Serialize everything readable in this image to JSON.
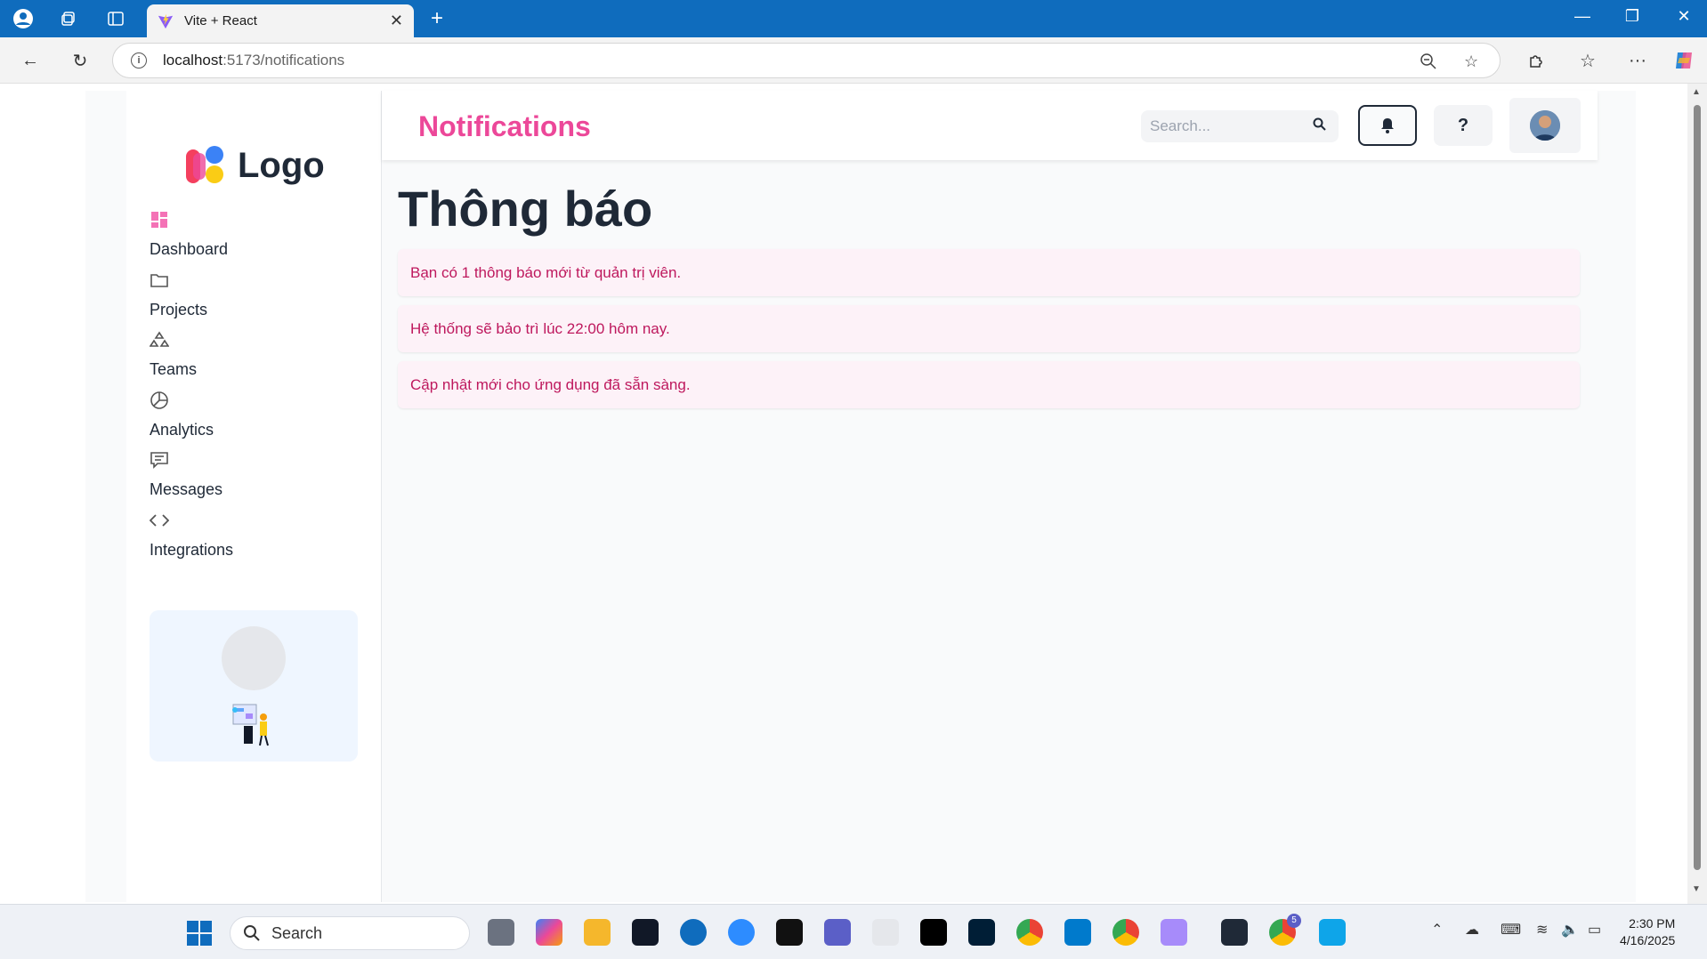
{
  "browser": {
    "tab_title": "Vite + React",
    "url_host": "localhost",
    "url_rest": ":5173/notifications"
  },
  "sidebar": {
    "logo_text": "Logo",
    "items": [
      {
        "label": "Dashboard",
        "icon": "dashboard-grid-icon"
      },
      {
        "label": "Projects",
        "icon": "folder-icon"
      },
      {
        "label": "Teams",
        "icon": "teams-icon"
      },
      {
        "label": "Analytics",
        "icon": "pie-chart-icon"
      },
      {
        "label": "Messages",
        "icon": "message-icon"
      },
      {
        "label": "Integrations",
        "icon": "code-icon"
      }
    ]
  },
  "header": {
    "title": "Notifications",
    "search_placeholder": "Search...",
    "help_label": "?"
  },
  "main": {
    "heading": "Thông báo",
    "notifications": [
      "Bạn có 1 thông báo mới từ quản trị viên.",
      "Hệ thống sẽ bảo trì lúc 22:00 hôm nay.",
      "Cập nhật mới cho ứng dụng đã sẵn sàng."
    ]
  },
  "taskbar": {
    "search_label": "Search",
    "time": "2:30 PM",
    "date": "4/16/2025",
    "notification_badge": "5"
  },
  "colors": {
    "accent": "#ec4899",
    "notification_bg": "#fdf2f8",
    "notification_text": "#be185d",
    "browser_titlebar": "#0f6cbd"
  }
}
